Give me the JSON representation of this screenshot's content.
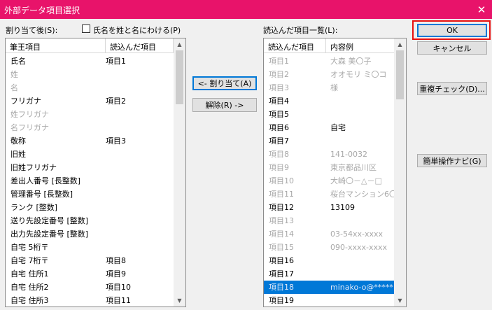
{
  "window": {
    "title": "外部データ項目選択",
    "close_glyph": "✕"
  },
  "assigned": {
    "label": "割り当て後(S):",
    "columns": [
      "筆王項目",
      "読込んだ項目"
    ],
    "rows": [
      {
        "field": "氏名",
        "value": "項目1",
        "dim": false
      },
      {
        "field": "姓",
        "value": "",
        "dim": true
      },
      {
        "field": "名",
        "value": "",
        "dim": true
      },
      {
        "field": "フリガナ",
        "value": "項目2",
        "dim": false
      },
      {
        "field": "姓フリガナ",
        "value": "",
        "dim": true
      },
      {
        "field": "名フリガナ",
        "value": "",
        "dim": true
      },
      {
        "field": "敬称",
        "value": "項目3",
        "dim": false
      },
      {
        "field": "旧姓",
        "value": "",
        "dim": false
      },
      {
        "field": "旧姓フリガナ",
        "value": "",
        "dim": false
      },
      {
        "field": "差出人番号 [長整数]",
        "value": "",
        "dim": false
      },
      {
        "field": "管理番号 [長整数]",
        "value": "",
        "dim": false
      },
      {
        "field": "ランク [整数]",
        "value": "",
        "dim": false
      },
      {
        "field": "送り先設定番号 [整数]",
        "value": "",
        "dim": false
      },
      {
        "field": "出力先設定番号 [整数]",
        "value": "",
        "dim": false
      },
      {
        "field": "自宅 5桁〒",
        "value": "",
        "dim": false
      },
      {
        "field": "自宅 7桁〒",
        "value": "項目8",
        "dim": false
      },
      {
        "field": "自宅 住所1",
        "value": "項目9",
        "dim": false
      },
      {
        "field": "自宅 住所2",
        "value": "項目10",
        "dim": false
      },
      {
        "field": "自宅 住所3",
        "value": "項目11",
        "dim": false
      }
    ],
    "scroll": {
      "thumb_start": 0.0,
      "thumb_size": 0.22
    }
  },
  "split_name": {
    "label": "氏名を姓と名にわける(P)",
    "checked": false
  },
  "buttons": {
    "assign": "<- 割り当て(A)",
    "release": "解除(R) ->",
    "ok": "OK",
    "cancel": "キャンセル",
    "dup_check": "重複チェック(D)...",
    "easy_navi": "簡単操作ナビ(G)"
  },
  "loaded": {
    "label": "読込んだ項目一覧(L):",
    "columns": [
      "読込んだ項目",
      "内容例"
    ],
    "rows": [
      {
        "item": "項目1",
        "example": "大森 美〇子",
        "dim": true,
        "selected": false
      },
      {
        "item": "項目2",
        "example": "オオモリ ミ〇コ",
        "dim": true,
        "selected": false
      },
      {
        "item": "項目3",
        "example": "様",
        "dim": true,
        "selected": false
      },
      {
        "item": "項目4",
        "example": "",
        "dim": false,
        "selected": false
      },
      {
        "item": "項目5",
        "example": "",
        "dim": false,
        "selected": false
      },
      {
        "item": "項目6",
        "example": "自宅",
        "dim": false,
        "selected": false
      },
      {
        "item": "項目7",
        "example": "",
        "dim": false,
        "selected": false
      },
      {
        "item": "項目8",
        "example": "141-0032",
        "dim": true,
        "selected": false
      },
      {
        "item": "項目9",
        "example": "東京都品川区",
        "dim": true,
        "selected": false
      },
      {
        "item": "項目10",
        "example": "大崎〇－△－□",
        "dim": true,
        "selected": false
      },
      {
        "item": "項目11",
        "example": "桜台マンション6〇",
        "dim": true,
        "selected": false
      },
      {
        "item": "項目12",
        "example": "13109",
        "dim": false,
        "selected": false
      },
      {
        "item": "項目13",
        "example": "",
        "dim": true,
        "selected": false
      },
      {
        "item": "項目14",
        "example": "03-54xx-xxxx",
        "dim": true,
        "selected": false
      },
      {
        "item": "項目15",
        "example": "090-xxxx-xxxx",
        "dim": true,
        "selected": false
      },
      {
        "item": "項目16",
        "example": "",
        "dim": false,
        "selected": false
      },
      {
        "item": "項目17",
        "example": "",
        "dim": false,
        "selected": false
      },
      {
        "item": "項目18",
        "example": "minako-o@*****:",
        "dim": true,
        "selected": true
      },
      {
        "item": "項目19",
        "example": "",
        "dim": false,
        "selected": false
      }
    ],
    "scroll": {
      "thumb_start": 0.0,
      "thumb_size": 0.2
    }
  }
}
